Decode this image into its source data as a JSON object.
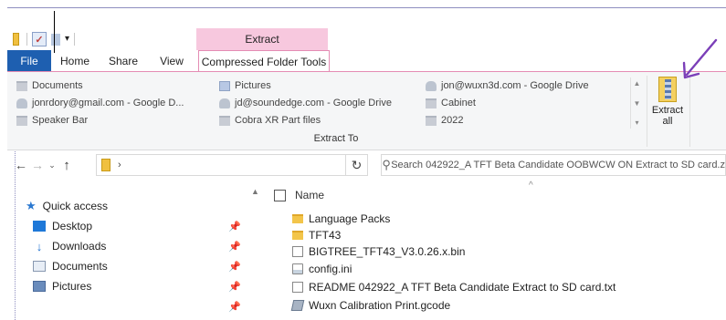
{
  "quick_access_toolbar": {
    "dropdown_glyph": "▾"
  },
  "ribbon": {
    "context_header": "Extract",
    "tabs": [
      {
        "label": "File"
      },
      {
        "label": "Home"
      },
      {
        "label": "Share"
      },
      {
        "label": "View"
      },
      {
        "label": "Compressed Folder Tools"
      }
    ],
    "extract_to_items": [
      {
        "label": "Documents",
        "icon": "folder-icon"
      },
      {
        "label": "jonrdory@gmail.com - Google D...",
        "icon": "google-drive-icon"
      },
      {
        "label": "Speaker Bar",
        "icon": "folder-icon"
      },
      {
        "label": "Pictures",
        "icon": "pictures-icon"
      },
      {
        "label": "jd@soundedge.com - Google Drive",
        "icon": "google-drive-icon"
      },
      {
        "label": "Cobra XR Part files",
        "icon": "folder-icon"
      },
      {
        "label": "jon@wuxn3d.com - Google Drive",
        "icon": "google-drive-icon"
      },
      {
        "label": "Cabinet",
        "icon": "folder-icon"
      },
      {
        "label": "2022",
        "icon": "folder-icon"
      }
    ],
    "group_label": "Extract To",
    "extract_all_label_line1": "Extract",
    "extract_all_label_line2": "all"
  },
  "address_bar": {
    "path_text": "›",
    "search_placeholder": "Search 042922_A TFT Beta Candidate OOBWCW ON Extract to SD card.z"
  },
  "nav_pane": {
    "quick_access_label": "Quick access",
    "items": [
      {
        "label": "Desktop",
        "icon": "desktop-icon"
      },
      {
        "label": "Downloads",
        "icon": "downloads-icon"
      },
      {
        "label": "Documents",
        "icon": "documents-icon"
      },
      {
        "label": "Pictures",
        "icon": "pictures-icon"
      }
    ]
  },
  "file_list": {
    "column_name": "Name",
    "files": [
      {
        "name": "Language Packs",
        "icon": "folder-icon"
      },
      {
        "name": "TFT43",
        "icon": "folder-icon"
      },
      {
        "name": "BIGTREE_TFT43_V3.0.26.x.bin",
        "icon": "file-icon"
      },
      {
        "name": "config.ini",
        "icon": "config-file-icon"
      },
      {
        "name": "README 042922_A TFT Beta Candidate Extract to SD card.txt",
        "icon": "text-file-icon"
      },
      {
        "name": "Wuxn Calibration Print.gcode",
        "icon": "gcode-file-icon"
      }
    ]
  },
  "colors": {
    "file_tab": "#1e5fb0",
    "context_header": "#f7c8de",
    "context_border": "#e48cb4",
    "annotation_arrow": "#7b3fb8",
    "folder": "#f3c54a",
    "accent_blue": "#2a78d0"
  }
}
